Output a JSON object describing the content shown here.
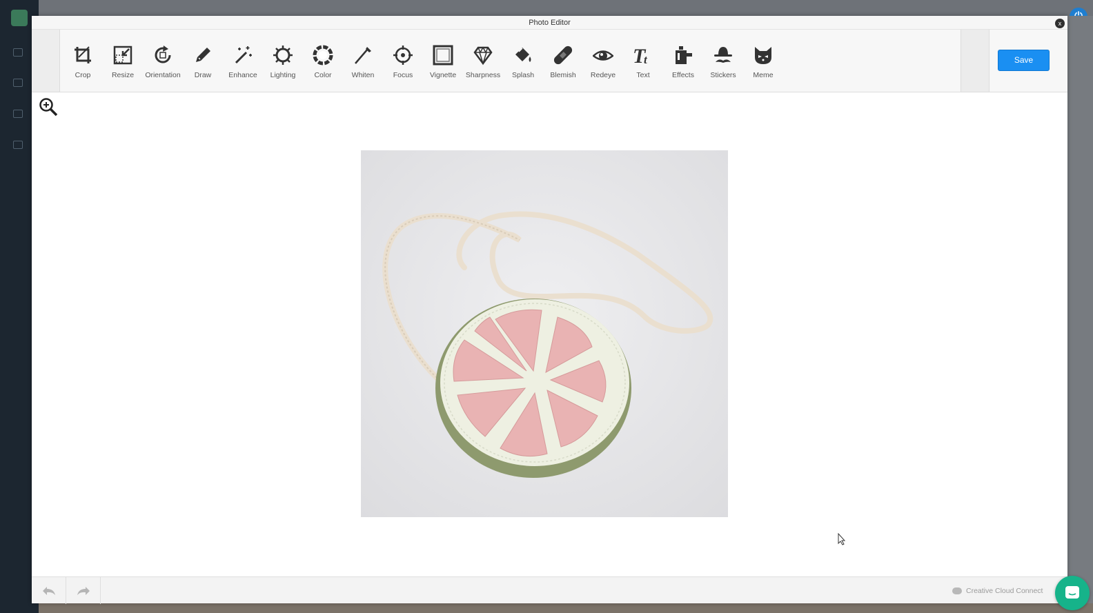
{
  "window": {
    "title": "Photo Editor",
    "close_label": "x"
  },
  "toolbar": {
    "tools": [
      {
        "label": "Crop",
        "icon": "crop-icon"
      },
      {
        "label": "Resize",
        "icon": "resize-icon"
      },
      {
        "label": "Orientation",
        "icon": "rotate-icon"
      },
      {
        "label": "Draw",
        "icon": "pencil-icon"
      },
      {
        "label": "Enhance",
        "icon": "magic-wand-icon"
      },
      {
        "label": "Lighting",
        "icon": "sun-icon"
      },
      {
        "label": "Color",
        "icon": "color-ring-icon"
      },
      {
        "label": "Whiten",
        "icon": "whiten-brush-icon"
      },
      {
        "label": "Focus",
        "icon": "target-icon"
      },
      {
        "label": "Vignette",
        "icon": "vignette-frame-icon"
      },
      {
        "label": "Sharpness",
        "icon": "diamond-icon"
      },
      {
        "label": "Splash",
        "icon": "paint-bucket-icon"
      },
      {
        "label": "Blemish",
        "icon": "bandage-icon"
      },
      {
        "label": "Redeye",
        "icon": "eye-icon"
      },
      {
        "label": "Text",
        "icon": "text-icon"
      },
      {
        "label": "Effects",
        "icon": "effects-icon"
      },
      {
        "label": "Stickers",
        "icon": "hat-mustache-icon"
      },
      {
        "label": "Meme",
        "icon": "cat-face-icon"
      }
    ],
    "save_label": "Save"
  },
  "footer": {
    "connect_label": "Creative Cloud Connect"
  },
  "colors": {
    "accent": "#1a8ff2",
    "chat": "#16b38a",
    "sidebar": "#1c2630"
  }
}
